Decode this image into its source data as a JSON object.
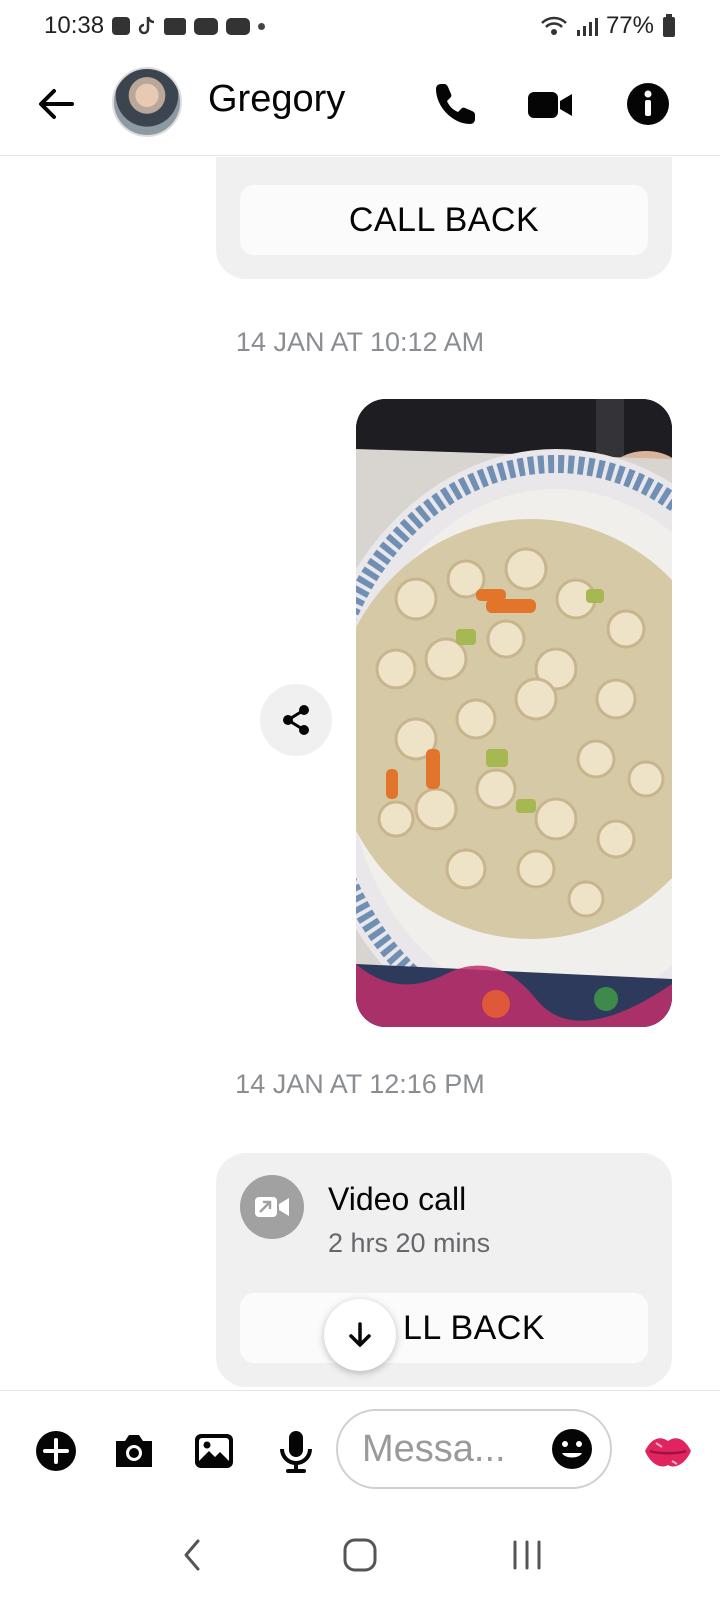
{
  "status_bar": {
    "time": "10:38",
    "battery": "77%"
  },
  "header": {
    "contact_name": "Gregory"
  },
  "thread": {
    "top_call": {
      "callback_label": "CALL BACK"
    },
    "timestamp_1": "14 JAN AT 10:12 AM",
    "timestamp_2": "14 JAN AT 12:16 PM",
    "bottom_call": {
      "title": "Video call",
      "duration": "2 hrs 20 mins",
      "callback_label": "LL BACK"
    }
  },
  "composer": {
    "placeholder": "Messa..."
  },
  "colors": {
    "kiss_accent": "#e0245e",
    "card_bg": "#f0f0f0",
    "timestamp": "#8a8d91"
  }
}
